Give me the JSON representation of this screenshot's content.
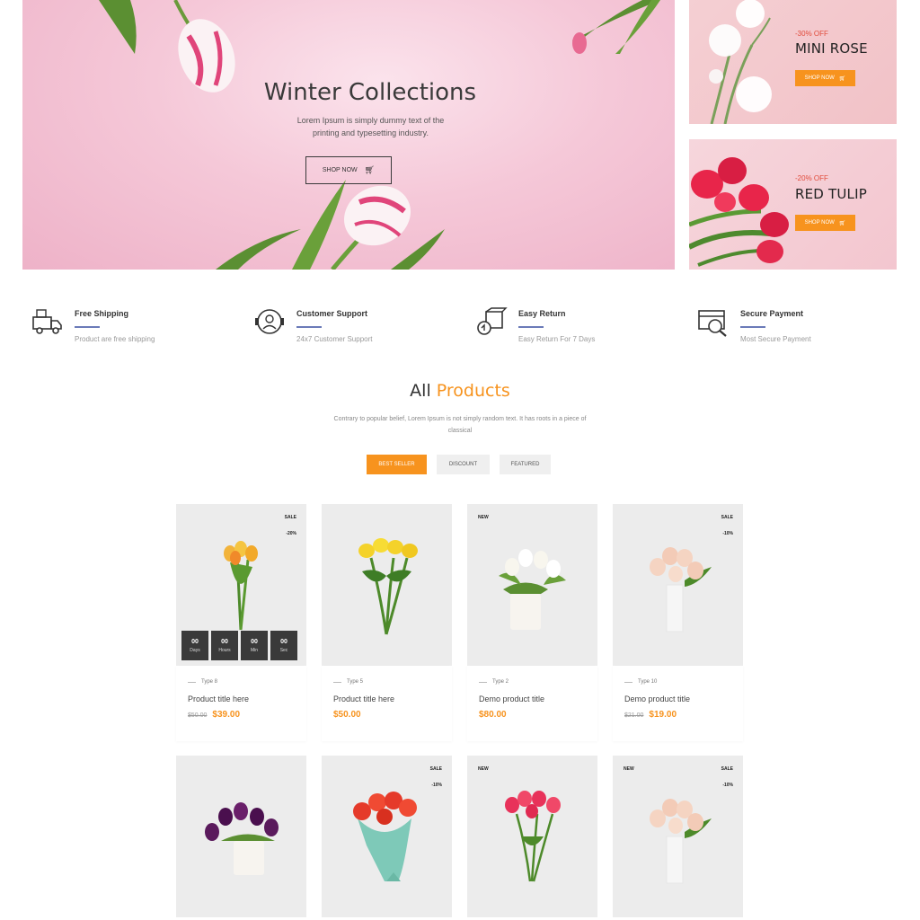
{
  "hero": {
    "title": "Winter Collections",
    "text": "Lorem Ipsum is simply dummy text of the printing and typesetting industry.",
    "button_label": "SHOP NOW"
  },
  "promos": [
    {
      "discount": "-30% OFF",
      "name": "MINI ROSE",
      "button_label": "SHOP NOW"
    },
    {
      "discount": "-20% OFF",
      "name": "RED TULIP",
      "button_label": "SHOP NOW"
    }
  ],
  "features": [
    {
      "title": "Free Shipping",
      "subtitle": "Product are free shipping",
      "icon": "truck-icon"
    },
    {
      "title": "Customer Support",
      "subtitle": "24x7 Customer Support",
      "icon": "support-icon"
    },
    {
      "title": "Easy Return",
      "subtitle": "Easy Return For 7 Days",
      "icon": "return-box-icon"
    },
    {
      "title": "Secure Payment",
      "subtitle": "Most Secure Payment",
      "icon": "secure-payment-icon"
    }
  ],
  "products_section": {
    "title_plain": "All",
    "title_accent": "Products",
    "description": "Contrary to popular belief, Lorem Ipsum is not simply random text. It has roots in a piece of classical",
    "tabs": [
      "BEST SELLER",
      "DISCOUNT",
      "FEATURED"
    ],
    "active_tab": "BEST SELLER"
  },
  "countdown": [
    {
      "value": "00",
      "label": "Days"
    },
    {
      "value": "00",
      "label": "Hours"
    },
    {
      "value": "00",
      "label": "Min"
    },
    {
      "value": "00",
      "label": "Sec"
    }
  ],
  "products": [
    {
      "type": "Type 8",
      "title": "Product title here",
      "old_price": "$50.00",
      "price": "$39.00",
      "sale": "SALE",
      "discount": "-20%",
      "new": ""
    },
    {
      "type": "Type 5",
      "title": "Product title here",
      "old_price": "",
      "price": "$50.00",
      "sale": "",
      "discount": "",
      "new": ""
    },
    {
      "type": "Type 2",
      "title": "Demo product title",
      "old_price": "",
      "price": "$80.00",
      "sale": "",
      "discount": "",
      "new": "NEW"
    },
    {
      "type": "Type 10",
      "title": "Demo product title",
      "old_price": "$21.00",
      "price": "$19.00",
      "sale": "SALE",
      "discount": "-10%",
      "new": ""
    },
    {
      "sale": "",
      "discount": "",
      "new": ""
    },
    {
      "sale": "SALE",
      "discount": "-10%",
      "new": ""
    },
    {
      "sale": "",
      "discount": "",
      "new": "NEW"
    },
    {
      "sale": "SALE",
      "discount": "-10%",
      "new": "NEW"
    }
  ],
  "colors": {
    "accent": "#f7931e",
    "promo_discount": "#e14b3b",
    "feature_line": "#6a7ab8",
    "card_bg": "#ececec"
  }
}
